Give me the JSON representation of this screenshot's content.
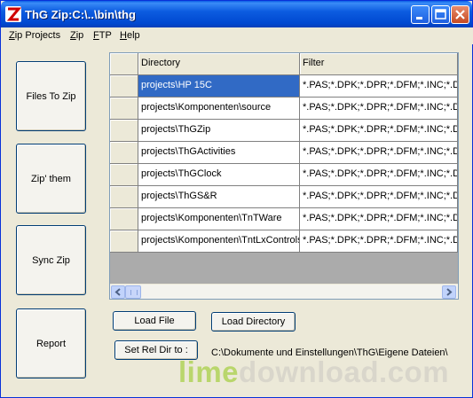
{
  "window": {
    "title": "ThG Zip:C:\\..\\bin\\thg"
  },
  "menu": [
    {
      "label": "Zip Projects",
      "accel": "Z",
      "rest": "ip Projects"
    },
    {
      "label": "Zip",
      "accel": "Z",
      "rest": "ip"
    },
    {
      "label": "FTP",
      "accel": "F",
      "rest": "TP"
    },
    {
      "label": "Help",
      "accel": "H",
      "rest": "elp"
    }
  ],
  "side_buttons": {
    "files_to_zip": "Files To Zip",
    "zip_them": "Zip' them",
    "sync_zip": "Sync Zip",
    "report": "Report"
  },
  "grid": {
    "columns": [
      "Directory",
      "Filter"
    ],
    "selected_row": 0,
    "rows": [
      {
        "directory": "projects\\HP 15C",
        "filter": "*.PAS;*.DPK;*.DPR;*.DFM;*.INC;*.D("
      },
      {
        "directory": "projects\\Komponenten\\source",
        "filter": "*.PAS;*.DPK;*.DPR;*.DFM;*.INC;*.D("
      },
      {
        "directory": "projects\\ThGZip",
        "filter": "*.PAS;*.DPK;*.DPR;*.DFM;*.INC;*.D("
      },
      {
        "directory": "projects\\ThGActivities",
        "filter": "*.PAS;*.DPK;*.DPR;*.DFM;*.INC;*.D("
      },
      {
        "directory": "projects\\ThGClock",
        "filter": "*.PAS;*.DPK;*.DPR;*.DFM;*.INC;*.D("
      },
      {
        "directory": "projects\\ThGS&R",
        "filter": "*.PAS;*.DPK;*.DPR;*.DFM;*.INC;*.D("
      },
      {
        "directory": "projects\\Komponenten\\TnTWare",
        "filter": "*.PAS;*.DPK;*.DPR;*.DFM;*.INC;*.D("
      },
      {
        "directory": "projects\\Komponenten\\TntLxControls",
        "filter": "*.PAS;*.DPK;*.DPR;*.DFM;*.INC;*.D("
      }
    ]
  },
  "actions": {
    "load_file": "Load File",
    "load_directory": "Load Directory",
    "set_rel_dir": "Set Rel Dir to :",
    "rel_dir_path": "C:\\Dokumente und Einstellungen\\ThG\\Eigene Dateien\\"
  },
  "watermark": {
    "lime": "lime",
    "rest": "download.com"
  },
  "colors": {
    "selection": "#316ac5",
    "titlebar": "#0054e3",
    "close_button": "#c64a22",
    "window_bg": "#ece9d8"
  }
}
